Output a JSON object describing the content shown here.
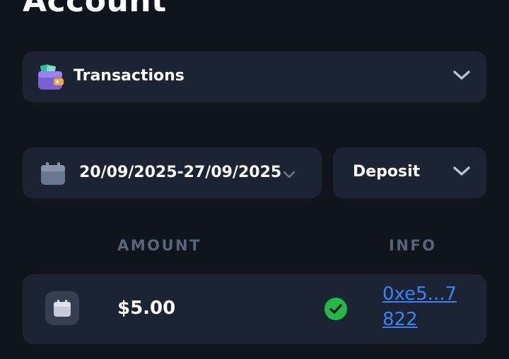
{
  "page": {
    "title": "Account"
  },
  "section_select": {
    "value": "Transactions",
    "icon": "wallet-icon"
  },
  "filters": {
    "date_range": "20/09/2025-27/09/2025",
    "type": "Deposit"
  },
  "table": {
    "columns": {
      "amount": "AMOUNT",
      "info": "INFO"
    },
    "rows": [
      {
        "type_icon": "calendar-icon",
        "amount": "$5.00",
        "status": "success",
        "info_line1": "0xe5...7",
        "info_line2": "822"
      }
    ]
  },
  "colors": {
    "background": "#0f141d",
    "card": "#1c2333",
    "link": "#3b82f6",
    "success": "#22b845",
    "muted": "#58647a"
  }
}
